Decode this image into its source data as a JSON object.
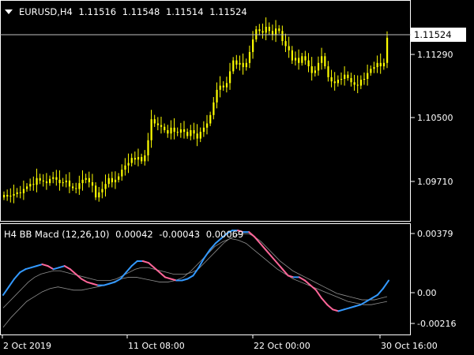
{
  "main_chart": {
    "dropdown_icon": "triangle-down-icon",
    "title": "EURUSD,H4",
    "ohlc": [
      "1.11516",
      "1.11548",
      "1.11514",
      "1.11524"
    ],
    "current_price_label": "1.11524",
    "price_labels": [
      "1.11290",
      "1.10500",
      "1.09710"
    ],
    "candle_color": "#ffff00",
    "price_line_color": "#c0c0c0",
    "frame_color": "#ffffff"
  },
  "indicator": {
    "title": "H4 BB Macd (12,26,10)",
    "values": [
      "0.00042",
      "-0.00043",
      "0.00069"
    ],
    "scale_labels": [
      "0.00379",
      "0.00",
      "-0.00216"
    ],
    "colors": {
      "up": "#3399ff",
      "down": "#ff6699",
      "band": "#909090"
    }
  },
  "time_axis": {
    "labels": [
      "2 Oct 2019",
      "11 Oct 08:00",
      "22 Oct 00:00",
      "30 Oct 16:00"
    ]
  },
  "chart_data": [
    {
      "type": "candlestick",
      "title": "EURUSD,H4",
      "ylim": [
        1.0935,
        1.1195
      ],
      "x_labels": [
        "2 Oct 2019",
        "11 Oct 08:00",
        "22 Oct 00:00",
        "30 Oct 16:00"
      ],
      "close": [
        1.0965,
        1.0963,
        1.0964,
        1.0966,
        1.0968,
        1.0967,
        1.0972,
        1.0975,
        1.0978,
        1.0977,
        1.0985,
        1.0982,
        1.0981,
        1.0979,
        1.0984,
        1.0986,
        1.0983,
        1.0979,
        1.098,
        1.0982,
        1.0975,
        1.0973,
        1.0972,
        1.0979,
        1.0983,
        1.0985,
        1.098,
        1.0976,
        1.0962,
        1.0968,
        1.0972,
        1.0978,
        1.0985,
        1.098,
        1.0983,
        1.0987,
        1.0995,
        1.1,
        1.1003,
        1.1009,
        1.1007,
        1.101,
        1.1005,
        1.1012,
        1.103,
        1.1055,
        1.105,
        1.1048,
        1.1046,
        1.1042,
        1.1038,
        1.1045,
        1.104,
        1.1039,
        1.1043,
        1.104,
        1.1035,
        1.1042,
        1.1038,
        1.1032,
        1.104,
        1.1045,
        1.105,
        1.106,
        1.1075,
        1.109,
        1.1095,
        1.1093,
        1.1098,
        1.1112,
        1.1125,
        1.112,
        1.1122,
        1.1117,
        1.1122,
        1.1135,
        1.115,
        1.1162,
        1.116,
        1.1158,
        1.1165,
        1.116,
        1.1155,
        1.1163,
        1.116,
        1.1148,
        1.1142,
        1.1137,
        1.1125,
        1.1128,
        1.1122,
        1.113,
        1.1125,
        1.1118,
        1.111,
        1.1113,
        1.1122,
        1.113,
        1.1118,
        1.1105,
        1.11,
        1.1098,
        1.1102,
        1.1103,
        1.1108,
        1.1104,
        1.1099,
        1.1096,
        1.1095,
        1.1102,
        1.1103,
        1.111,
        1.1115,
        1.1117,
        1.1122,
        1.1118,
        1.1122,
        1.1152
      ]
    },
    {
      "type": "line",
      "title": "H4 BB Macd (12,26,10)",
      "ylim": [
        -0.0026,
        0.0041
      ],
      "series": [
        {
          "name": "",
          "values": [
            -0.0002,
            0.0003,
            0.0008,
            0.0012,
            0.0014,
            0.0015,
            0.0016,
            0.0017,
            0.0016,
            0.0014,
            0.0015,
            0.0016,
            0.0014,
            0.0011,
            0.0008,
            0.0006,
            0.0005,
            0.0004,
            0.0004,
            0.0005,
            0.0006,
            0.0008,
            0.0012,
            0.0016,
            0.0019,
            0.0019,
            0.0018,
            0.0015,
            0.0012,
            0.0009,
            0.0008,
            0.0007,
            0.0007,
            0.0008,
            0.001,
            0.0015,
            0.0021,
            0.0026,
            0.003,
            0.0033,
            0.0036,
            0.0038,
            0.0038,
            0.0037,
            0.0037,
            0.0034,
            0.003,
            0.0026,
            0.0022,
            0.0018,
            0.0014,
            0.001,
            0.0009,
            0.0009,
            0.0007,
            0.0004,
            0.0001,
            -0.0004,
            -0.0008,
            -0.0011,
            -0.0012,
            -0.0011,
            -0.001,
            -0.0009,
            -0.0008,
            -0.0006,
            -0.0004,
            -0.0002,
            0.0002,
            0.0007
          ]
        },
        {
          "name": "",
          "values": [
            -0.001,
            -0.0006,
            -0.0002,
            0.0002,
            0.0006,
            0.0009,
            0.0011,
            0.0012,
            0.0013,
            0.0013,
            0.0012,
            0.0011,
            0.001,
            0.0009,
            0.0008,
            0.0007,
            0.0007,
            0.0007,
            0.0008,
            0.001,
            0.0012,
            0.0014,
            0.0015,
            0.0015,
            0.0014,
            0.0013,
            0.0012,
            0.0011,
            0.0011,
            0.0011,
            0.0012,
            0.0014,
            0.0018,
            0.0022,
            0.0026,
            0.003,
            0.0033,
            0.0035,
            0.0036,
            0.0036,
            0.0034,
            0.0031,
            0.0027,
            0.0023,
            0.0019,
            0.0016,
            0.0013,
            0.0011,
            0.0009,
            0.0007,
            0.0005,
            0.0003,
            0.0001,
            -0.0001,
            -0.0002,
            -0.0003,
            -0.0004,
            -0.0005,
            -0.0005,
            -0.0005,
            -0.0004,
            -0.0003
          ]
        },
        {
          "name": "",
          "values": [
            -0.0022,
            -0.0016,
            -0.0011,
            -0.0006,
            -0.0003,
            0.0,
            0.0002,
            0.0003,
            0.0002,
            0.0001,
            0.0001,
            0.0002,
            0.0003,
            0.0004,
            0.0006,
            0.0008,
            0.0009,
            0.0009,
            0.0008,
            0.0007,
            0.0006,
            0.0006,
            0.0007,
            0.0009,
            0.0013,
            0.0018,
            0.0023,
            0.0028,
            0.0031,
            0.0033,
            0.0032,
            0.003,
            0.0026,
            0.0022,
            0.0018,
            0.0014,
            0.0011,
            0.0008,
            0.0006,
            0.0004,
            0.0002,
            0.0,
            -0.0002,
            -0.0004,
            -0.0006,
            -0.0007,
            -0.0008,
            -0.0008,
            -0.0007,
            -0.0006
          ]
        }
      ]
    }
  ]
}
